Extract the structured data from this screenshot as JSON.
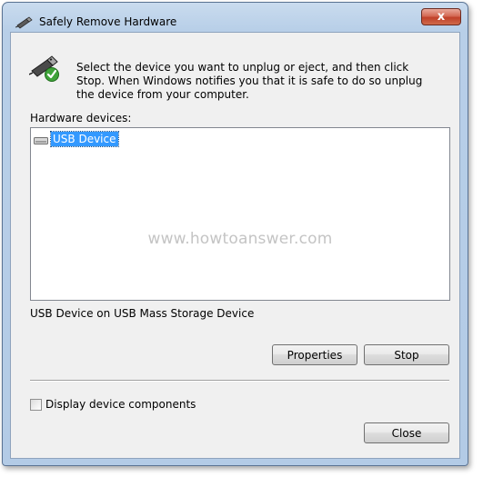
{
  "window": {
    "title": "Safely Remove Hardware",
    "close_glyph": "x"
  },
  "instructions": "Select the device you want to unplug or eject, and then click Stop. When Windows notifies you that it is safe to do so unplug the device from your computer.",
  "hardware": {
    "label": "Hardware devices:",
    "devices": [
      {
        "name": "USB Device",
        "icon": "usb-drive-icon",
        "selected": true
      }
    ],
    "description": "USB Device on USB Mass Storage Device"
  },
  "watermark": "www.howtoanswer.com",
  "buttons": {
    "properties": "Properties",
    "stop": "Stop",
    "close": "Close"
  },
  "options": {
    "display_components_label": "Display device components",
    "display_components_checked": false
  },
  "colors": {
    "selection": "#3399ff",
    "close_button": "#c0412a",
    "title_bar": "#b8cfe8"
  }
}
